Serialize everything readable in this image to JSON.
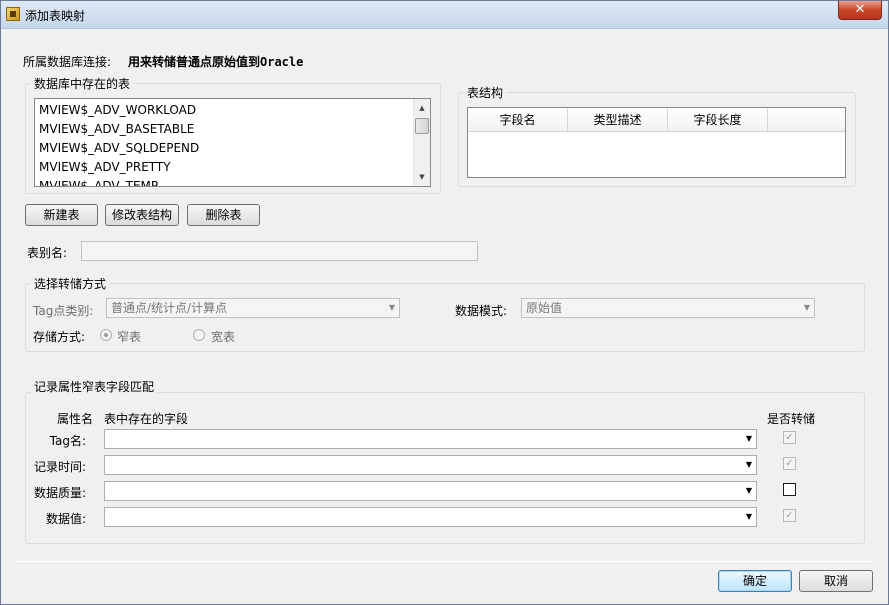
{
  "window": {
    "title": "添加表映射",
    "close_label": "✕"
  },
  "connection": {
    "label": "所属数据库连接:",
    "value": "用来转储普通点原始值到Oracle"
  },
  "tables_group": {
    "title": "数据库中存在的表",
    "items": [
      "MVIEW$_ADV_WORKLOAD",
      "MVIEW$_ADV_BASETABLE",
      "MVIEW$_ADV_SQLDEPEND",
      "MVIEW$_ADV_PRETTY",
      "MVIEW$_ADV_TEMP"
    ]
  },
  "structure_group": {
    "title": "表结构",
    "columns": [
      "字段名",
      "类型描述",
      "字段长度"
    ]
  },
  "buttons": {
    "new_table": "新建表",
    "modify_table": "修改表结构",
    "delete_table": "删除表",
    "ok": "确定",
    "cancel": "取消"
  },
  "alias": {
    "label": "表别名:",
    "value": ""
  },
  "storage_group": {
    "title": "选择转储方式",
    "tag_type_label": "Tag点类别:",
    "tag_type_value": "普通点/统计点/计算点",
    "data_mode_label": "数据模式:",
    "data_mode_value": "原始值",
    "storage_label": "存储方式:",
    "narrow_label": "窄表",
    "wide_label": "宽表",
    "narrow_selected": true
  },
  "mapping_group": {
    "title": "记录属性窄表字段匹配",
    "col_attr": "属性名",
    "col_field": "表中存在的字段",
    "col_convert": "是否转储",
    "rows": [
      {
        "label": "Tag名:",
        "checked": true,
        "enabled": false
      },
      {
        "label": "记录时间:",
        "checked": true,
        "enabled": false
      },
      {
        "label": "数据质量:",
        "checked": false,
        "enabled": true
      },
      {
        "label": "数据值:",
        "checked": true,
        "enabled": false
      }
    ]
  }
}
